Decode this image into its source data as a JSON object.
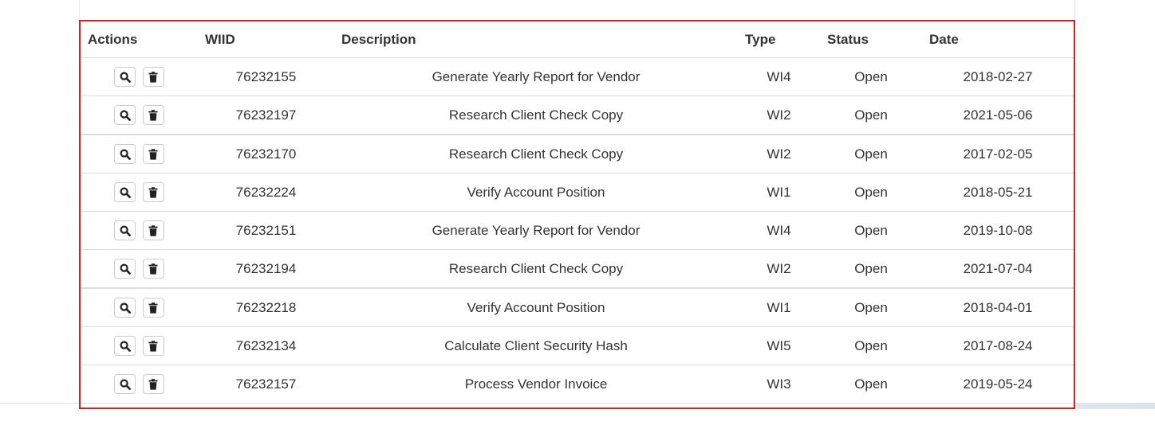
{
  "table": {
    "headers": {
      "actions": "Actions",
      "wiid": "WIID",
      "description": "Description",
      "type": "Type",
      "status": "Status",
      "date": "Date"
    },
    "action_icons": [
      "search-icon",
      "trash-icon"
    ],
    "rows": [
      {
        "wiid": "76232155",
        "description": "Generate Yearly Report for Vendor",
        "type": "WI4",
        "status": "Open",
        "date": "2018-02-27"
      },
      {
        "wiid": "76232197",
        "description": "Research Client Check Copy",
        "type": "WI2",
        "status": "Open",
        "date": "2021-05-06"
      },
      {
        "wiid": "76232170",
        "description": "Research Client Check Copy",
        "type": "WI2",
        "status": "Open",
        "date": "2017-02-05"
      },
      {
        "wiid": "76232224",
        "description": "Verify Account Position",
        "type": "WI1",
        "status": "Open",
        "date": "2018-05-21"
      },
      {
        "wiid": "76232151",
        "description": "Generate Yearly Report for Vendor",
        "type": "WI4",
        "status": "Open",
        "date": "2019-10-08"
      },
      {
        "wiid": "76232194",
        "description": "Research Client Check Copy",
        "type": "WI2",
        "status": "Open",
        "date": "2021-07-04"
      },
      {
        "wiid": "76232218",
        "description": "Verify Account Position",
        "type": "WI1",
        "status": "Open",
        "date": "2018-04-01"
      },
      {
        "wiid": "76232134",
        "description": "Calculate Client Security Hash",
        "type": "WI5",
        "status": "Open",
        "date": "2017-08-24"
      },
      {
        "wiid": "76232157",
        "description": "Process Vendor Invoice",
        "type": "WI3",
        "status": "Open",
        "date": "2019-05-24"
      }
    ]
  },
  "colors": {
    "highlight_border": "#e01b1b",
    "row_border": "#dddddd",
    "text": "#333333"
  }
}
